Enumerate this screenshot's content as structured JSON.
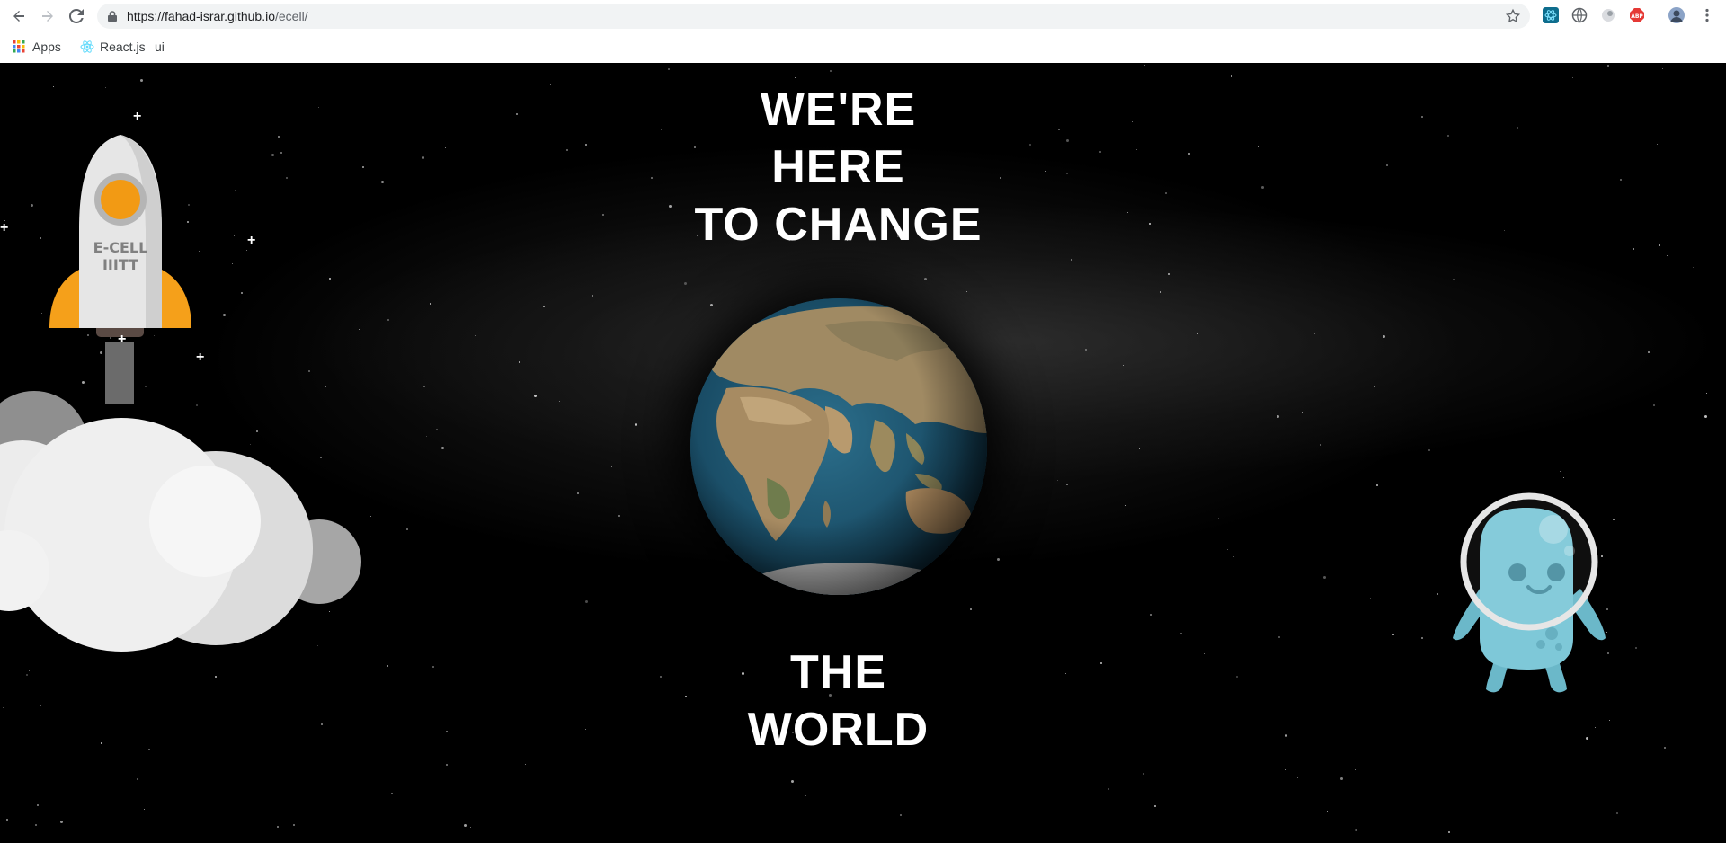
{
  "browser": {
    "url_host": "https://fahad-israr.github.io",
    "url_path": "/ecell/",
    "bookmarks": [
      {
        "label": "Apps",
        "icon": "apps-grid-icon"
      },
      {
        "label": "React.js",
        "icon": "react-icon"
      },
      {
        "label": "ui",
        "icon": ""
      }
    ]
  },
  "hero": {
    "line1": "WE'RE",
    "line2": "HERE",
    "line3": "TO CHANGE",
    "line4": "THE",
    "line5": "WORLD"
  },
  "rocket": {
    "badge_line1": "E-CELL",
    "badge_line2": "IIITT"
  },
  "colors": {
    "background": "#000000",
    "rocket_accent": "#f5a01a",
    "rocket_body": "#e6e6e6",
    "alien": "#7ec8d8",
    "headline": "#ffffff"
  }
}
